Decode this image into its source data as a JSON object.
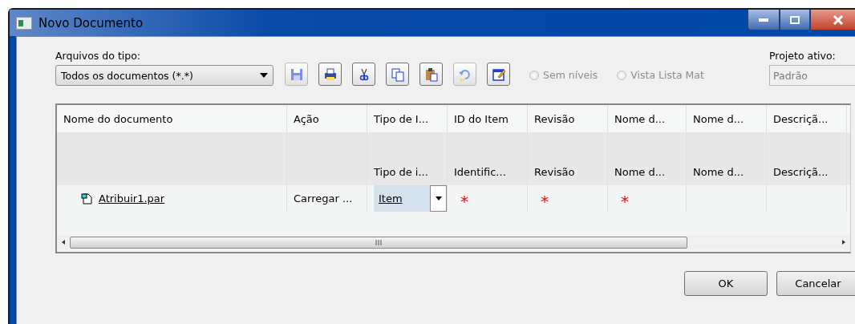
{
  "window": {
    "title": "Novo Documento"
  },
  "file_type": {
    "label": "Arquivos do tipo:",
    "value": "Todos os documentos (*.*)"
  },
  "options": [
    {
      "label": "Sem níveis",
      "selected": false,
      "disabled": true
    },
    {
      "label": "Vista Lista Mat",
      "selected": false,
      "disabled": true
    }
  ],
  "project": {
    "label": "Projeto ativo:",
    "value": "Padrão"
  },
  "table": {
    "columns": [
      "Nome do documento",
      "Ação",
      "Tipo de I...",
      "ID do Item",
      "Revisão",
      "Nome d...",
      "Nome d...",
      "Descriçã..."
    ],
    "subheader": [
      "Tipo de i...",
      "Identific...",
      "Revisão",
      "Nome d...",
      "Nome d...",
      "Descriçã..."
    ],
    "rows": [
      {
        "document": "Atribuir1.par",
        "action": "Carregar ...",
        "item_type": "Item",
        "item_type_selected": true,
        "required": [
          "*",
          "*",
          "*"
        ]
      }
    ]
  },
  "buttons": [
    "OK",
    "Cancelar"
  ]
}
